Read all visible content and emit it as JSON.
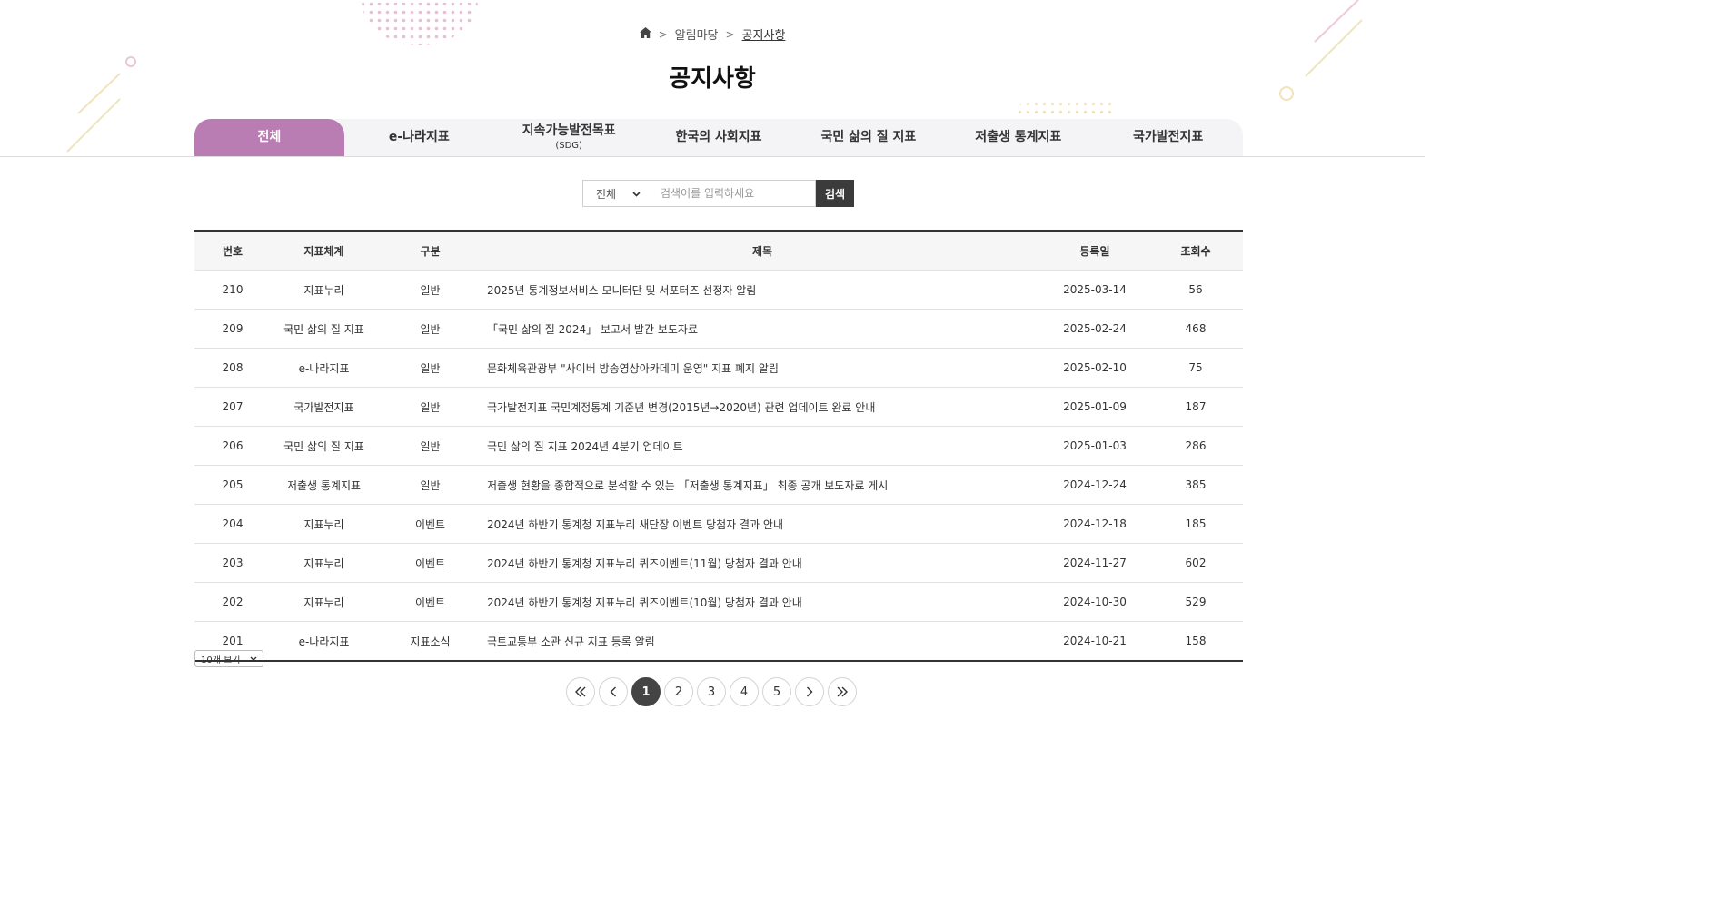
{
  "breadcrumb": {
    "section": "알림마당",
    "current": "공지사항"
  },
  "page_title": "공지사항",
  "tabs": [
    {
      "label": "전체",
      "sub": ""
    },
    {
      "label": "e-나라지표",
      "sub": ""
    },
    {
      "label": "지속가능발전목표",
      "sub": "(SDG)"
    },
    {
      "label": "한국의 사회지표",
      "sub": ""
    },
    {
      "label": "국민 삶의 질 지표",
      "sub": ""
    },
    {
      "label": "저출생 통계지표",
      "sub": ""
    },
    {
      "label": "국가발전지표",
      "sub": ""
    }
  ],
  "search": {
    "select_value": "전체",
    "placeholder": "검색어를 입력하세요",
    "button": "검색"
  },
  "table": {
    "headers": {
      "no": "번호",
      "system": "지표체계",
      "type": "구분",
      "title": "제목",
      "date": "등록일",
      "views": "조회수"
    },
    "rows": [
      {
        "no": "210",
        "system": "지표누리",
        "type": "일반",
        "title": "2025년 통계정보서비스 모니터단 및 서포터즈 선정자 알림",
        "date": "2025-03-14",
        "views": "56"
      },
      {
        "no": "209",
        "system": "국민 삶의 질 지표",
        "type": "일반",
        "title": "「국민 삶의 질 2024」 보고서 발간 보도자료",
        "date": "2025-02-24",
        "views": "468"
      },
      {
        "no": "208",
        "system": "e-나라지표",
        "type": "일반",
        "title": "문화체육관광부 \"사이버 방송영상아카데미 운영\" 지표 폐지 알림",
        "date": "2025-02-10",
        "views": "75"
      },
      {
        "no": "207",
        "system": "국가발전지표",
        "type": "일반",
        "title": "국가발전지표 국민계정통계 기준년 변경(2015년→2020년) 관련 업데이트 완료 안내",
        "date": "2025-01-09",
        "views": "187"
      },
      {
        "no": "206",
        "system": "국민 삶의 질 지표",
        "type": "일반",
        "title": "국민 삶의 질 지표 2024년 4분기 업데이트",
        "date": "2025-01-03",
        "views": "286"
      },
      {
        "no": "205",
        "system": "저출생 통계지표",
        "type": "일반",
        "title": "저출생 현황을 종합적으로 분석할 수 있는 「저출생 통계지표」 최종 공개 보도자료 게시",
        "date": "2024-12-24",
        "views": "385"
      },
      {
        "no": "204",
        "system": "지표누리",
        "type": "이벤트",
        "title": "2024년 하반기 통계청 지표누리 새단장 이벤트 당첨자 결과 안내",
        "date": "2024-12-18",
        "views": "185"
      },
      {
        "no": "203",
        "system": "지표누리",
        "type": "이벤트",
        "title": "2024년 하반기 통계청 지표누리 퀴즈이벤트(11월) 당첨자 결과 안내",
        "date": "2024-11-27",
        "views": "602"
      },
      {
        "no": "202",
        "system": "지표누리",
        "type": "이벤트",
        "title": "2024년 하반기 통계청 지표누리 퀴즈이벤트(10월) 당첨자 결과 안내",
        "date": "2024-10-30",
        "views": "529"
      },
      {
        "no": "201",
        "system": "e-나라지표",
        "type": "지표소식",
        "title": "국토교통부 소관 신규 지표 등록 알림",
        "date": "2024-10-21",
        "views": "158"
      }
    ]
  },
  "per_page": "10개 보기",
  "pagination": {
    "pages": [
      "1",
      "2",
      "3",
      "4",
      "5"
    ],
    "current": "1"
  },
  "colors": {
    "accent": "#b97db3",
    "dark_button": "#3b3b3b"
  }
}
